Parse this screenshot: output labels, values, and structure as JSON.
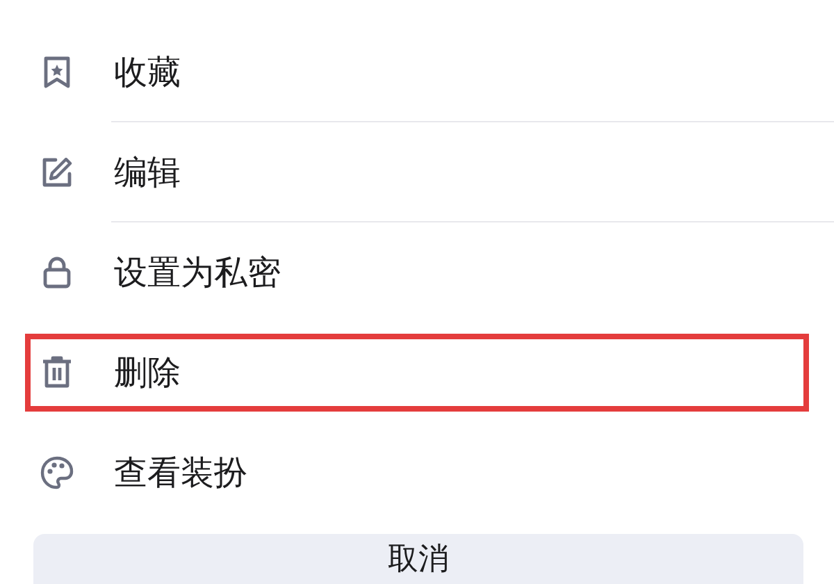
{
  "menu": {
    "items": [
      {
        "kind": "favorite",
        "label": "收藏",
        "highlighted": false
      },
      {
        "kind": "edit",
        "label": "编辑",
        "highlighted": false
      },
      {
        "kind": "private",
        "label": "设置为私密",
        "highlighted": false
      },
      {
        "kind": "delete",
        "label": "删除",
        "highlighted": true
      },
      {
        "kind": "appearance",
        "label": "查看装扮",
        "highlighted": false
      }
    ]
  },
  "cancel_button": {
    "label": "取消"
  }
}
